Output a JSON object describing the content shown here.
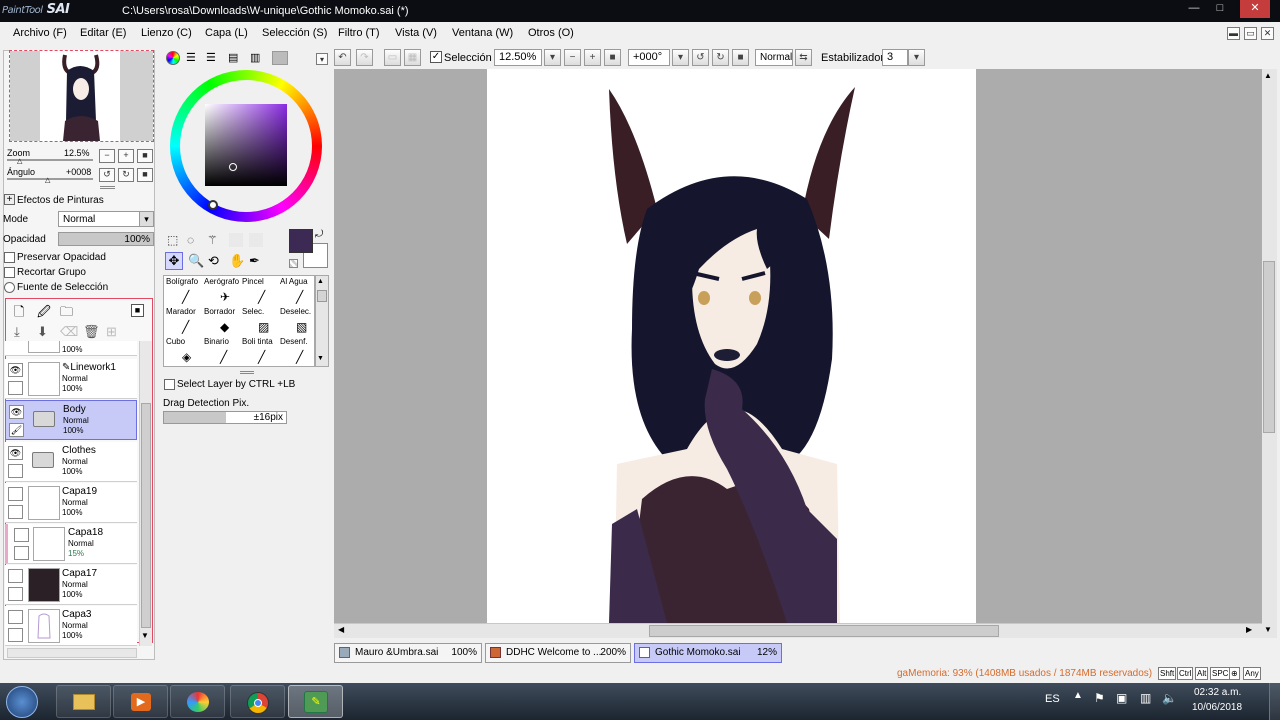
{
  "window": {
    "app_logo_text": "PaintTool SAI",
    "title": "C:\\Users\\rosa\\Downloads\\W-unique\\Gothic Momoko.sai (*)",
    "controls": {
      "minimize": "—",
      "maximize": "□",
      "close": "✕"
    }
  },
  "menu": [
    "Archivo (F)",
    "Editar (E)",
    "Lienzo (C)",
    "Capa (L)",
    "Selección (S)",
    "Filtro (T)",
    "Vista (V)",
    "Ventana (W)",
    "Otros (O)"
  ],
  "toolbar": {
    "selection_label": "Selección",
    "selection_checked": true,
    "zoom_value": "12.50%",
    "rotation_value": "+000°",
    "blend_mode": "Normal",
    "stabilizer_label": "Estabilizador",
    "stabilizer_value": "3"
  },
  "navigator": {
    "zoom_label": "Zoom",
    "zoom_value": "12.5%",
    "angle_label": "Ángulo",
    "angle_value": "+0008"
  },
  "layer_props": {
    "effects_label": "Efectos de Pinturas",
    "mode_label": "Mode",
    "mode_value": "Normal",
    "opacity_label": "Opacidad",
    "opacity_value": "100%",
    "opacity_fraction": 1.0,
    "preserve_opacity": "Preservar Opacidad",
    "clip_group": "Recortar Grupo",
    "selection_source": "Fuente de Selección"
  },
  "layers": [
    {
      "name": "",
      "mode": "",
      "opacity": "100%",
      "partial": true
    },
    {
      "name": "Linework1",
      "mode": "Normal",
      "opacity": "100%",
      "visible": true,
      "selected": false,
      "folder": false,
      "thumb": "#ffffff",
      "pen_icon": true
    },
    {
      "name": "Body",
      "mode": "Normal",
      "opacity": "100%",
      "visible": true,
      "selected": true,
      "folder": true,
      "thumb": "#d8d8d8"
    },
    {
      "name": "Clothes",
      "mode": "Normal",
      "opacity": "100%",
      "visible": true,
      "selected": false,
      "folder": true,
      "thumb": "#d8d8d8"
    },
    {
      "name": "Capa19",
      "mode": "Normal",
      "opacity": "100%",
      "visible": false,
      "selected": false,
      "folder": false,
      "thumb": "#ffffff"
    },
    {
      "name": "Capa18",
      "mode": "Normal",
      "opacity": "15%",
      "visible": false,
      "selected": false,
      "folder": false,
      "thumb": "#ffffff",
      "clip": true
    },
    {
      "name": "Capa17",
      "mode": "Normal",
      "opacity": "100%",
      "visible": false,
      "selected": false,
      "folder": false,
      "thumb": "#2a2026"
    },
    {
      "name": "Capa3",
      "mode": "Normal",
      "opacity": "100%",
      "visible": false,
      "selected": false,
      "folder": false,
      "thumb": "#f6f2f7"
    }
  ],
  "color": {
    "primary": "#3c2a55",
    "secondary": "#ffffff",
    "hue_accent": "#8a2be2"
  },
  "tools": {
    "select_layer_ctrl": "Select Layer by CTRL +LB",
    "drag_detection_label": "Drag Detection Pix.",
    "drag_detection_value": "±16pix"
  },
  "brushes": [
    {
      "name": "Bolígrafo",
      "icon": "pen-icon"
    },
    {
      "name": "Aerógrafo",
      "icon": "airbrush-icon"
    },
    {
      "name": "Pincel",
      "icon": "brush-icon"
    },
    {
      "name": "Al Agua",
      "icon": "watercolor-icon"
    },
    {
      "name": "Marador",
      "icon": "marker-icon"
    },
    {
      "name": "Borrador",
      "icon": "eraser-icon"
    },
    {
      "name": "Selec.",
      "icon": "select-pen-icon"
    },
    {
      "name": "Deselec.",
      "icon": "deselect-pen-icon"
    },
    {
      "name": "Cubo",
      "icon": "bucket-icon"
    },
    {
      "name": "Binario",
      "icon": "binary-pen-icon"
    },
    {
      "name": "Boli tinta",
      "icon": "ink-pen-icon"
    },
    {
      "name": "Desenf.",
      "icon": "blur-icon"
    }
  ],
  "files": [
    {
      "name": "Mauro &Umbra.sai",
      "zoom": "100%",
      "active": false
    },
    {
      "name": "DDHC Welcome to ...",
      "zoom": "200%",
      "active": false
    },
    {
      "name": "Gothic Momoko.sai",
      "zoom": "12%",
      "active": true
    }
  ],
  "status": {
    "memory": "gaMemoria: 93% (1408MB usados / 1874MB reservados)",
    "keys": [
      "Shft",
      "Ctrl",
      "Alt",
      "SPC",
      "⊕",
      "Any"
    ]
  },
  "taskbar": {
    "language": "ES",
    "time": "02:32 a.m.",
    "date": "10/06/2018"
  }
}
